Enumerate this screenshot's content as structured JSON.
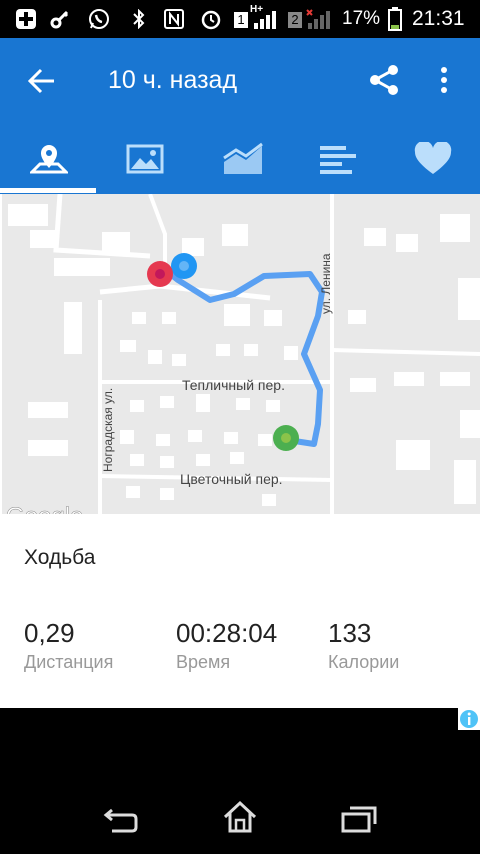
{
  "status_bar": {
    "battery_percent": "17%",
    "time": "21:31",
    "sim1": "1",
    "sim2": "2",
    "network_type": "H+",
    "icons": [
      "plus-notification-icon",
      "vpn-key-icon",
      "whatsapp-icon",
      "bluetooth-icon",
      "nfc-icon",
      "alarm-icon",
      "signal-icon",
      "battery-icon"
    ]
  },
  "app_bar": {
    "title": "10 ч. назад",
    "icons": [
      "back-arrow-icon",
      "share-icon",
      "overflow-menu-icon"
    ]
  },
  "tabs": [
    {
      "icon": "map-pin-icon",
      "active": true
    },
    {
      "icon": "photo-icon",
      "active": false
    },
    {
      "icon": "chart-icon",
      "active": false
    },
    {
      "icon": "bars-icon",
      "active": false
    },
    {
      "icon": "heart-icon",
      "active": false
    }
  ],
  "map": {
    "streets": [
      "ул. Ленина",
      "Тепличный пер.",
      "Ноградская ул.",
      "Цветочный пер."
    ],
    "route_color": "#5aa0f2",
    "markers": {
      "start": "#4caf50",
      "end": "#e53950",
      "current": "#2196f3"
    },
    "logo": "Google"
  },
  "summary": {
    "activity": "Ходьба",
    "stats": [
      {
        "value": "0,29",
        "label": "Дистанция"
      },
      {
        "value": "00:28:04",
        "label": "Время"
      },
      {
        "value": "133",
        "label": "Калории"
      }
    ]
  },
  "colors": {
    "primary": "#1976D2",
    "accent": "#ffffff"
  }
}
